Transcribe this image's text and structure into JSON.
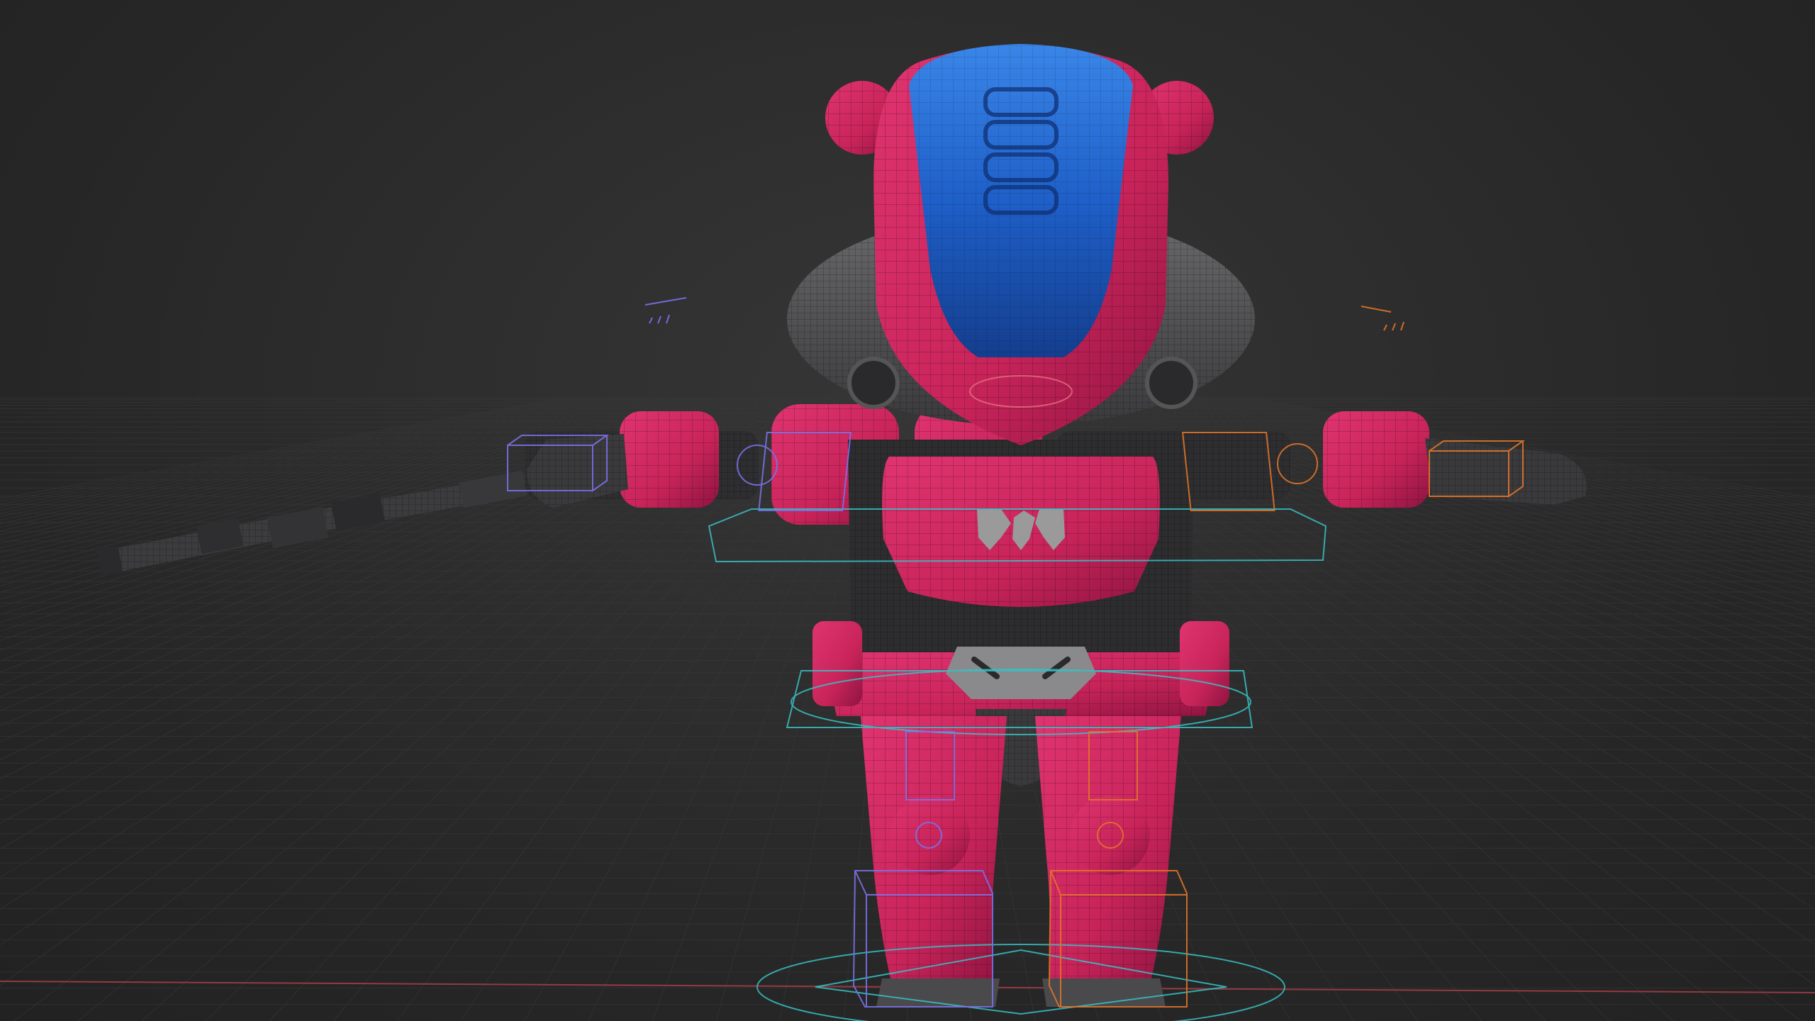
{
  "viewport": {
    "background_color": "#2a2a2a",
    "grid_line_color": "#3a3a3a",
    "x_axis_color": "#b04048"
  },
  "model": {
    "armor_color": "#c8245a",
    "armor_shadow": "#8e1440",
    "visor_color": "#1e5fc8",
    "joint_color": "#4a4a4c",
    "bodysuit_color": "#2d2d2f",
    "weapon_color": "#3a3a3c",
    "emblem_color": "#9a9a9a"
  },
  "rig": {
    "left_control_color": "#7a72e8",
    "right_control_color": "#e0742a",
    "center_control_color": "#38c0c4"
  },
  "icons": [
    "chest-emblem-icon"
  ]
}
